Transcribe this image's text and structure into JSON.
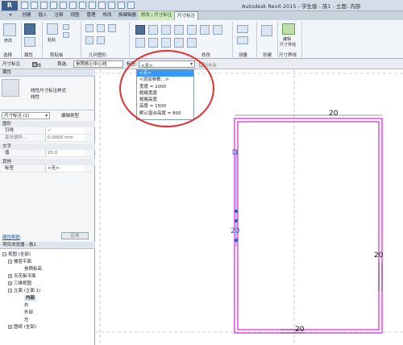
{
  "app": {
    "logo": "R",
    "title": "Autodesk Revit 2015 - 学生版 -   族1 - 立面: 内部"
  },
  "ribbon_tabs": [
    "创建",
    "插入",
    "注释",
    "视图",
    "管理",
    "修改",
    "族编辑器",
    "修改 | 尺寸标注",
    "尺寸标注"
  ],
  "ribbon": {
    "groups": [
      "选择",
      "属性",
      "剪贴板",
      "几何图形",
      "修改",
      "测量",
      "创建",
      "尺寸界线"
    ],
    "modify_label": "修改",
    "paste_label": "粘贴",
    "edit_witness_label": "编辑尺寸界线",
    "labels_small": [
      "编辑",
      "尺寸界线"
    ]
  },
  "options_bar": {
    "context": "尺寸标注",
    "leader_label": "引线",
    "pick_label": "首选:",
    "pick_value": "参照核心中心线",
    "label_label": "标签:",
    "label_value": "<无>",
    "instance_param_label": "实例参数"
  },
  "dropdown": {
    "options": [
      "<无>",
      "<添加参数...>",
      "宽度 = 1000",
      "粗略宽度",
      "粗略高度",
      "高度 = 1500",
      "默认窗台高度 = 800"
    ],
    "selected_index": 0
  },
  "properties": {
    "header": "属性",
    "type_name": "线性尺寸标注样式",
    "type_sub": "线性",
    "selector": "尺寸标注 (1)",
    "edit_type": "编辑类型",
    "categories": [
      {
        "name": "图形",
        "rows": [
          {
            "k": "引线",
            "v": "✓"
          },
          {
            "k": "基线偏移...",
            "v": "0.0000 mm"
          }
        ]
      },
      {
        "name": "文字",
        "rows": [
          {
            "k": "值",
            "v": "20.0"
          }
        ]
      },
      {
        "name": "其他",
        "rows": [
          {
            "k": "标签",
            "v": "<无>"
          }
        ]
      }
    ],
    "help_link": "属性帮助",
    "apply_button": "应用"
  },
  "project_browser": {
    "header": "项目浏览器 - 族1",
    "items": [
      {
        "label": "视图 (全部)",
        "level": 0
      },
      {
        "label": "楼层平面",
        "level": 1
      },
      {
        "label": "参照标高",
        "level": 2
      },
      {
        "label": "天花板平面",
        "level": 1
      },
      {
        "label": "三维视图",
        "level": 1
      },
      {
        "label": "立面 (立面 1)",
        "level": 1
      },
      {
        "label": "内部",
        "level": 2,
        "selected": true
      },
      {
        "label": "右",
        "level": 2
      },
      {
        "label": "外部",
        "level": 2
      },
      {
        "label": "左",
        "level": 2
      },
      {
        "label": "图纸 (全部)",
        "level": 0
      }
    ]
  },
  "canvas": {
    "dims": {
      "top": "20",
      "left": "20",
      "right": "20",
      "bottom": "20"
    }
  },
  "colors": {
    "accent": "#3399ff",
    "ribbon_bg": "#f2f5f9",
    "context_tab": "#cfe8c0",
    "circle": "#e03030",
    "frame": "#e23fe6"
  }
}
